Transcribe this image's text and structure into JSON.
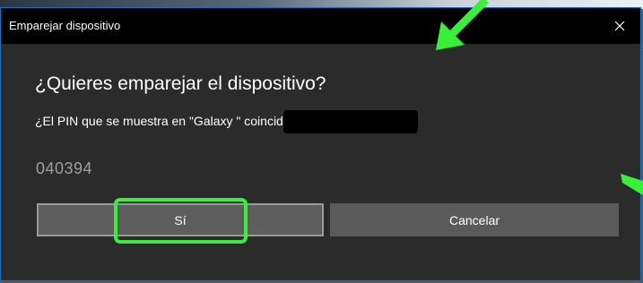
{
  "window": {
    "title": "Emparejar dispositivo",
    "close_glyph": "✕"
  },
  "dialog": {
    "heading": "¿Quieres emparejar el dispositivo?",
    "question": "¿El PIN que se muestra en \"Galaxy                                                 \" coincide con el PIN siguiente?",
    "pin": "040394"
  },
  "buttons": {
    "yes_label": "Sí",
    "cancel_label": "Cancelar"
  },
  "annotations": {
    "highlight_color": "#39f039",
    "arrow_color": "#39f039"
  },
  "colors": {
    "dialog_bg": "#2b2b2b",
    "titlebar_bg": "#000000",
    "border_accent": "#1f6fb8",
    "button_bg": "#5a5a5a",
    "pin_text": "#a0a0a0"
  }
}
